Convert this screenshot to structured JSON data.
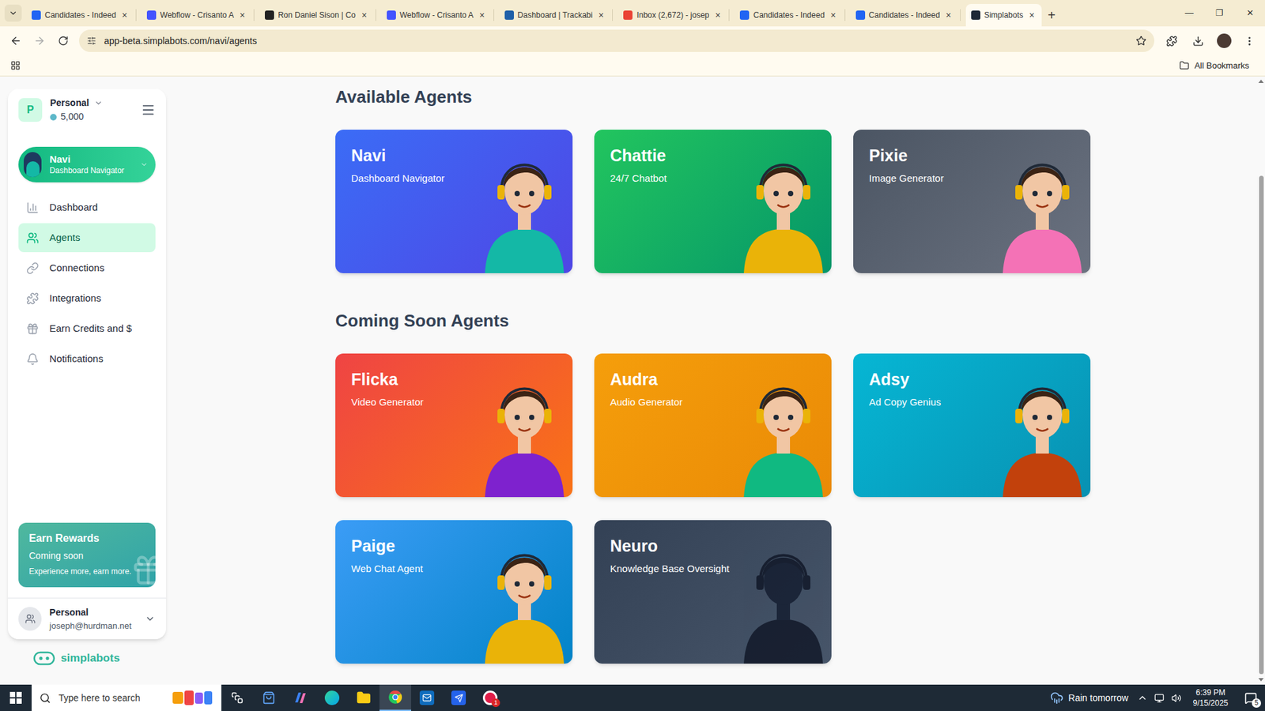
{
  "browser": {
    "tabs": [
      {
        "label": "Candidates - Indeed",
        "selected": false,
        "color": "#2164f3"
      },
      {
        "label": "Webflow - Crisanto A",
        "selected": false,
        "color": "#4353ff"
      },
      {
        "label": "Ron Daniel Sison | Co",
        "selected": false,
        "color": "#222222"
      },
      {
        "label": "Webflow - Crisanto A",
        "selected": false,
        "color": "#4353ff"
      },
      {
        "label": "Dashboard | Trackabi",
        "selected": false,
        "color": "#1f5fa8"
      },
      {
        "label": "Inbox (2,672) - josep",
        "selected": false,
        "color": "#ea4335"
      },
      {
        "label": "Candidates - Indeed",
        "selected": false,
        "color": "#2164f3"
      },
      {
        "label": "Candidates - Indeed",
        "selected": false,
        "color": "#2164f3"
      },
      {
        "label": "Simplabots",
        "selected": true,
        "color": "#1f2937"
      }
    ],
    "tab_close": "×",
    "new_tab": "+",
    "window_controls": [
      "—",
      "❐",
      "✕"
    ],
    "address": "app-beta.simplabots.com/navi/agents",
    "bookmarks": {
      "label": "All Bookmarks"
    }
  },
  "sidebar": {
    "workspace": {
      "initial": "P",
      "name": "Personal",
      "credits": "5,000"
    },
    "agent": {
      "name": "Navi",
      "role": "Dashboard Navigator"
    },
    "items": [
      {
        "label": "Dashboard",
        "selected": false
      },
      {
        "label": "Agents",
        "selected": true
      },
      {
        "label": "Connections",
        "selected": false
      },
      {
        "label": "Integrations",
        "selected": false
      },
      {
        "label": "Earn Credits and $",
        "selected": false
      },
      {
        "label": "Notifications",
        "selected": false
      }
    ],
    "rewards": {
      "title": "Earn Rewards",
      "status": "Coming soon",
      "text": "Experience more, earn more."
    },
    "account": {
      "name": "Personal",
      "email": "joseph@hurdman.net"
    },
    "logo": "simplabots"
  },
  "sections": [
    {
      "title": "Available Agents",
      "agents": [
        {
          "name": "Navi",
          "role": "Dashboard Navigator",
          "color": "#3b6cf6",
          "color_end": "#4f46e5",
          "suit": "#14b8a6",
          "silhouette": false
        },
        {
          "name": "Chattie",
          "role": "24/7 Chatbot",
          "color": "#22c55e",
          "color_end": "#059669",
          "suit": "#eab308",
          "silhouette": false
        },
        {
          "name": "Pixie",
          "role": "Image Generator",
          "color": "#4b5563",
          "color_end": "#6b7280",
          "suit": "#f472b6",
          "silhouette": false
        }
      ]
    },
    {
      "title": "Coming Soon Agents",
      "agents": [
        {
          "name": "Flicka",
          "role": "Video Generator",
          "color": "#ef4444",
          "color_end": "#f97316",
          "suit": "#7e22ce",
          "silhouette": false
        },
        {
          "name": "Audra",
          "role": "Audio Generator",
          "color": "#f59e0b",
          "color_end": "#ea8a06",
          "suit": "#10b981",
          "silhouette": false
        },
        {
          "name": "Adsy",
          "role": "Ad Copy Genius",
          "color": "#06b6d4",
          "color_end": "#0891b2",
          "suit": "#c2410c",
          "silhouette": false
        },
        {
          "name": "Paige",
          "role": "Web Chat Agent",
          "color": "#3b9cf6",
          "color_end": "#0284c7",
          "suit": "#eab308",
          "silhouette": false
        },
        {
          "name": "Neuro",
          "role": "Knowledge Base Oversight",
          "color": "#334155",
          "color_end": "#475569",
          "suit": "#111827",
          "silhouette": true
        }
      ]
    }
  ],
  "taskbar": {
    "search_placeholder": "Type here to search",
    "weather": "Rain tomorrow",
    "time": "6:39 PM",
    "date": "9/15/2025",
    "notifications": "5",
    "app_badge": "1"
  }
}
